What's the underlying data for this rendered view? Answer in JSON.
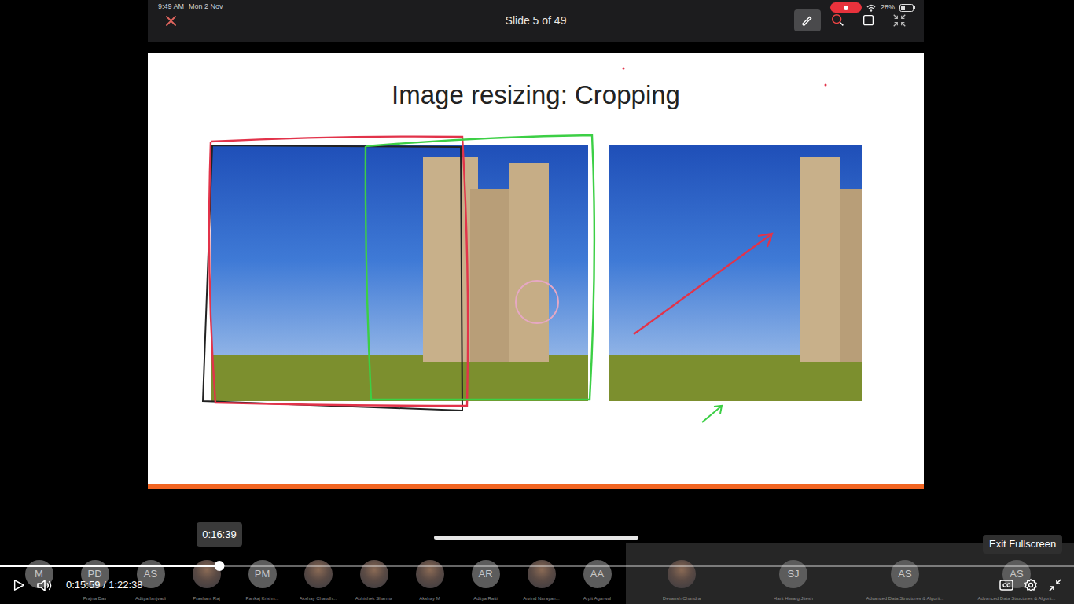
{
  "status_bar": {
    "time": "9:49 AM",
    "date": "Mon 2 Nov",
    "battery": "28%",
    "recording": true
  },
  "tools": [
    {
      "kind": "pen",
      "selected": true
    },
    {
      "kind": "lasso",
      "selected": false
    },
    {
      "kind": "window",
      "selected": false
    },
    {
      "kind": "shrink",
      "selected": false
    }
  ],
  "slide": {
    "counter": "Slide 5 of 49",
    "title": "Image resizing: Cropping"
  },
  "player": {
    "time": "0:15:59 / 1:22:38",
    "progress": 0.204,
    "playing": false,
    "hover_time": "0:16:39",
    "tooltip": "Exit Fullscreen"
  },
  "participants": [
    {
      "kind": "initials",
      "initials": "M",
      "name": ""
    },
    {
      "kind": "initials",
      "initials": "PD",
      "name": "Prajna Das"
    },
    {
      "kind": "initials",
      "initials": "AS",
      "name": "Aditya Ianjvadi"
    },
    {
      "kind": "photo",
      "initials": "",
      "name": "Prashant Raj"
    },
    {
      "kind": "initials",
      "initials": "PM",
      "name": "Pankaj Krishn..."
    },
    {
      "kind": "photo",
      "initials": "",
      "name": "Akshay Chaudh..."
    },
    {
      "kind": "photo",
      "initials": "",
      "name": "Abhishek Sharma"
    },
    {
      "kind": "photo",
      "initials": "",
      "name": "Akshay M"
    },
    {
      "kind": "initials",
      "initials": "AR",
      "name": "Aditya Ratti"
    },
    {
      "kind": "photo",
      "initials": "",
      "name": "Arvind Narayan..."
    },
    {
      "kind": "initials",
      "initials": "AA",
      "name": "Arpit Agarwal"
    },
    {
      "kind": "photo",
      "initials": "",
      "name": "Devansh Chandra"
    },
    {
      "kind": "initials",
      "initials": "SJ",
      "name": "Harit Hiwarg Jitesh"
    },
    {
      "kind": "initials",
      "initials": "AS",
      "name": "Advanced Data Structures & Algorit..."
    },
    {
      "kind": "initials",
      "initials": "AS",
      "name": "Advanced Data Structures & Algorit..."
    }
  ]
}
